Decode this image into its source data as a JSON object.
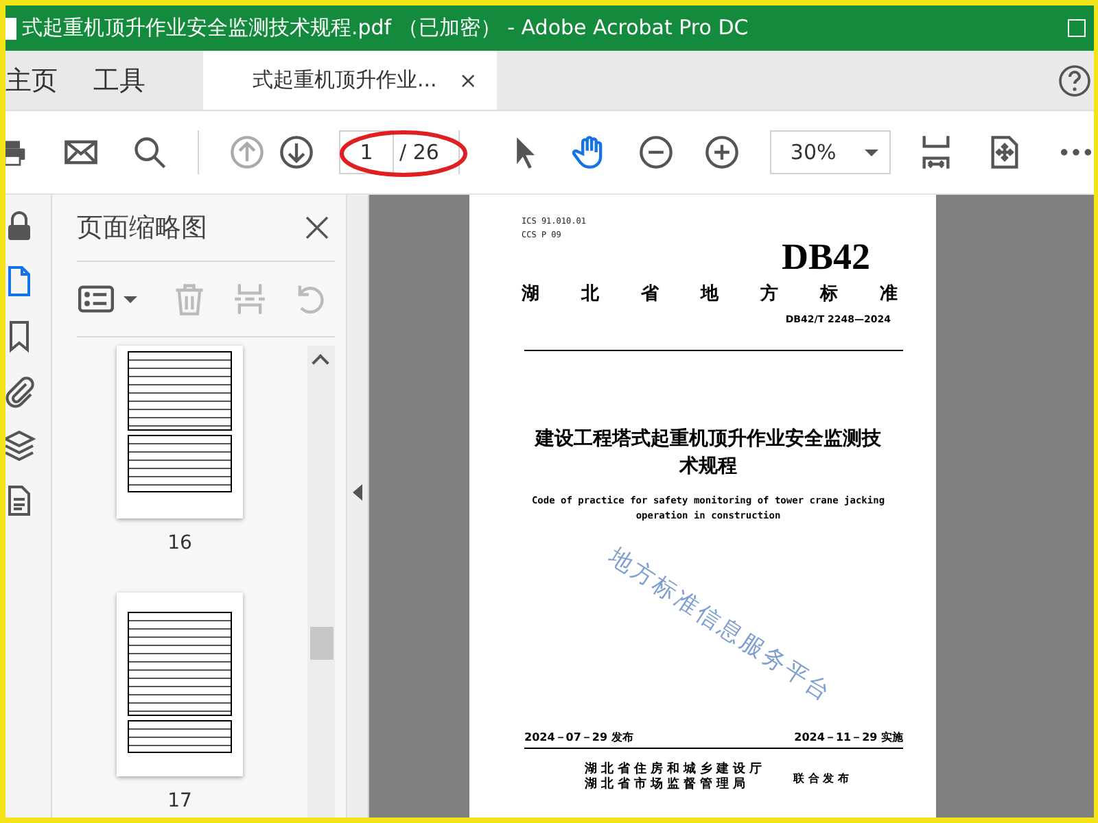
{
  "window": {
    "title": "式起重机顶升作业安全监测技术规程.pdf （已加密） - Adobe Acrobat Pro DC"
  },
  "tabs": [
    {
      "label": "主页",
      "selected": false
    },
    {
      "label": "工具",
      "selected": false
    },
    {
      "label": "式起重机顶升作业...",
      "selected": true,
      "close": "×"
    }
  ],
  "toolbar": {
    "items": [
      {
        "kind": "print",
        "disabled": false
      },
      {
        "kind": "mail",
        "disabled": false
      },
      {
        "kind": "search",
        "disabled": false
      },
      {
        "kind": "sep"
      },
      {
        "kind": "prev",
        "disabled": true
      },
      {
        "kind": "next",
        "disabled": false
      },
      {
        "kind": "page"
      },
      {
        "kind": "sep"
      },
      {
        "kind": "pointer",
        "selected": false
      },
      {
        "kind": "hand",
        "selected": true
      },
      {
        "kind": "zoomout",
        "disabled": false
      },
      {
        "kind": "zoomin",
        "disabled": false
      },
      {
        "kind": "zoom"
      },
      {
        "kind": "fitwidth",
        "disabled": false
      },
      {
        "kind": "fitpage",
        "disabled": false
      },
      {
        "kind": "more",
        "disabled": false
      }
    ],
    "page_field": {
      "value": "1",
      "total": "/ 26"
    },
    "zoom_field": {
      "value": "30%"
    }
  },
  "rail": [
    {
      "kind": "lock",
      "selected": false
    },
    {
      "kind": "pages",
      "selected": true
    },
    {
      "kind": "bookmark",
      "selected": false
    },
    {
      "kind": "clip",
      "selected": false
    },
    {
      "kind": "layers",
      "selected": false
    },
    {
      "kind": "doc",
      "selected": false
    }
  ],
  "panel": {
    "title": "页面缩略图",
    "tools": [
      {
        "kind": "options",
        "disabled": false
      },
      {
        "kind": "trash",
        "disabled": true
      },
      {
        "kind": "cut",
        "disabled": true
      },
      {
        "kind": "rotate",
        "disabled": true
      }
    ],
    "thumbnails": [
      {
        "label": "16"
      },
      {
        "label": "17"
      }
    ]
  },
  "document": {
    "ics": "ICS 91.010.01",
    "ccs": "CCS P 09",
    "code": "DB42",
    "category": "湖 北 省 地 方 标 准",
    "number": "DB42/T 2248—2024",
    "title": "建设工程塔式起重机顶升作业安全监测技术规程",
    "title_en": "Code of practice for safety monitoring of tower crane jacking operation in construction",
    "watermark": "地方标准信息服务平台",
    "issued": "2024－07－29 发布",
    "effective": "2024－11－29 实施",
    "issuers": [
      "湖北省住房和城乡建设厅",
      "湖北省市场监督管理局"
    ],
    "joint": "联 合 发 布"
  }
}
